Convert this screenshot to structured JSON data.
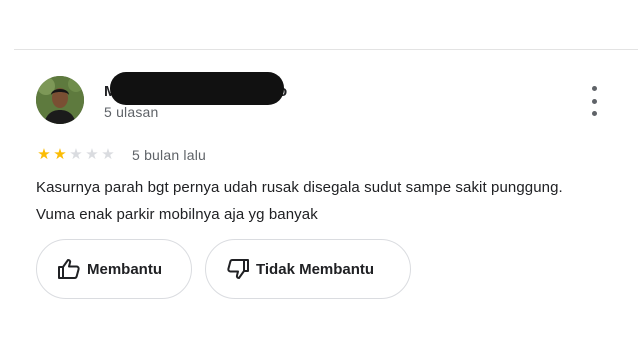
{
  "review": {
    "reviewer": {
      "name_visible_start": "M",
      "name_visible_end": "o",
      "review_count": "5 ulasan"
    },
    "rating": {
      "stars": 2,
      "max": 5
    },
    "date": "5 bulan lalu",
    "text_lines": [
      "Kasurnya parah bgt pernya udah rusak disegala sudut sampe sakit punggung.",
      "Vuma enak parkir mobilnya aja yg banyak"
    ],
    "actions": {
      "helpful_label": "Membantu",
      "not_helpful_label": "Tidak Membantu"
    },
    "colors": {
      "star_filled": "#fbbc04",
      "star_empty": "#dadce0",
      "secondary_text": "#5f6368",
      "border": "#dadce0"
    },
    "icons": [
      "thumbs-up-icon",
      "thumbs-down-icon",
      "more-vert-icon"
    ]
  }
}
